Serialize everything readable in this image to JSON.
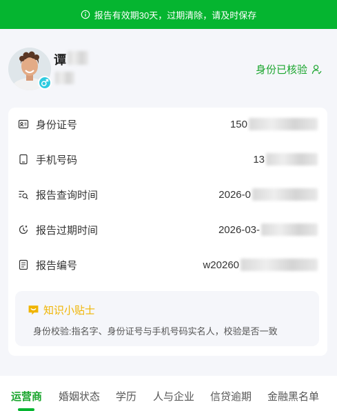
{
  "banner": {
    "text": "报告有效期30天，过期清除，请及时保存",
    "icon": "info-icon"
  },
  "profile": {
    "name_visible": "谭",
    "verified_label": "身份已核验",
    "verified_icon": "user-check-icon",
    "gender_icon": "male-icon"
  },
  "info_rows": [
    {
      "label": "身份证号",
      "value": "150",
      "icon": "id-card-icon"
    },
    {
      "label": "手机号码",
      "value": "13",
      "icon": "phone-icon"
    },
    {
      "label": "报告查询时间",
      "value": "2026-0",
      "icon": "search-list-icon"
    },
    {
      "label": "报告过期时间",
      "value": "2026-03-",
      "icon": "clock-icon"
    },
    {
      "label": "报告编号",
      "value": "w20260",
      "icon": "document-icon"
    }
  ],
  "tips": {
    "title": "知识小贴士",
    "text": "身份校验:指名字、身份证号与手机号码实名人，校验是否一致",
    "icon": "chat-bubble-icon"
  },
  "tabs": [
    {
      "label": "运营商",
      "active": true
    },
    {
      "label": "婚姻状态",
      "active": false
    },
    {
      "label": "学历",
      "active": false
    },
    {
      "label": "人与企业",
      "active": false
    },
    {
      "label": "信贷逾期",
      "active": false
    },
    {
      "label": "金融黑名单",
      "active": false
    }
  ],
  "colors": {
    "brand_green": "#05b530",
    "verified_green": "#1aa52d",
    "tip_yellow": "#f0b400",
    "gender_cyan": "#2ecbe0"
  }
}
